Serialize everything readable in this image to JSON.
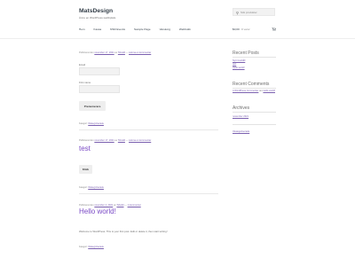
{
  "header": {
    "site_title": "MatsDesign",
    "site_description": "Ännu en WordPress-webbplats",
    "search_placeholder": "Sök produkter",
    "cart_amount": "$0,00",
    "cart_count": "0 varor"
  },
  "nav": {
    "items": [
      "Hem",
      "Kassa",
      "NSD Events",
      "Sample Page",
      "Varukorg",
      "Webbutik"
    ]
  },
  "posts": [
    {
      "meta_prefix": "Publicerat den",
      "date": "november 17, 2021",
      "by": "av",
      "author": "Tsbuild",
      "comments": "Lämna en kommentar",
      "email_label": "Email",
      "first_name_label": "First name",
      "button": "Prenumerera",
      "category_prefix": "Kategori:",
      "category": "Okategoriserade"
    },
    {
      "meta_prefix": "Publicerat den",
      "date": "november 17, 2021",
      "by": "av",
      "author": "Tsbuild",
      "comments": "Lämna en kommentar",
      "title": "test",
      "button": "Klick",
      "category_prefix": "Kategori:",
      "category": "Okategoriserade"
    },
    {
      "meta_prefix": "Publicerat den",
      "date": "november 4, 2021",
      "by": "av",
      "author": "Tsbuild",
      "comments": "1 kommentar",
      "title": "Hello world!",
      "body": "Welcome to WordPress. This is your first post. Edit or delete it, then start writing!",
      "category_prefix": "Kategori:",
      "category": "Okategoriserade"
    }
  ],
  "sidebar": {
    "recent_posts_title": "Recent Posts",
    "recent_posts": [
      "Nytt innehåll",
      "test",
      "Hello world!"
    ],
    "recent_comments_title": "Recent Comments",
    "comment_author": "A WordPress Commenter",
    "comment_on": "om",
    "comment_post": "Hello world!",
    "archives_title": "Archives",
    "archive": "november 2021",
    "categories": "Okategoriserade"
  }
}
